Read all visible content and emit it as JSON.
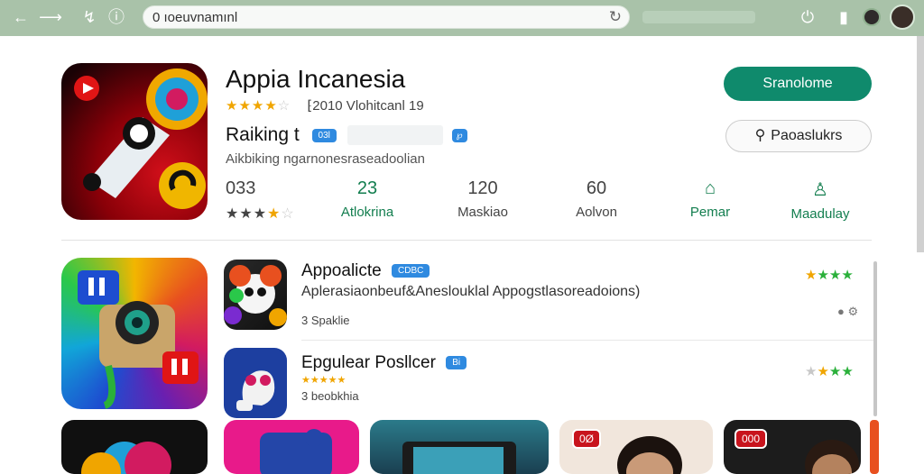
{
  "browser": {
    "url": "0 ıoeuvnamınl",
    "nav": [
      "back-arrow",
      "forward-arrow",
      "history-icon",
      "info-icon"
    ]
  },
  "app": {
    "title": "Appia Incanesia",
    "rating_stars": 4,
    "meta": "⁅2010     Vlohitcanl 19",
    "ranking_label": "Raiking t",
    "ranking_badge": "03l",
    "ranking_badge2": "℘",
    "subtitle": "Aikbiking ngarnonesraseadoolian",
    "stats": [
      {
        "value": "033",
        "label": "",
        "stars": 3
      },
      {
        "value": "23",
        "label": "Atlokrina"
      },
      {
        "value": "120",
        "label": "Maskiao"
      },
      {
        "value": "60",
        "label": "Aolvon"
      },
      {
        "value": "",
        "label": "Pemar"
      },
      {
        "value": "",
        "label": "Maadulay"
      }
    ],
    "install_label": "Sranolome",
    "secondary_label": "Paoaslukrs"
  },
  "list": [
    {
      "title": "Appoalicte",
      "badge": "CDBC",
      "desc": "Aplerasiaonbeuf&Aneslouklal Appogstlasoreadoions)",
      "count": "3 Spaklie",
      "stars": 4
    },
    {
      "title": "Epgulear Posllcer",
      "badge": "Bi",
      "desc": "",
      "count": "3 beobkhia",
      "stars": 4
    }
  ],
  "thumbs": [
    {
      "badge": ""
    },
    {
      "badge": ""
    },
    {
      "badge": ""
    },
    {
      "badge": "0Ø"
    },
    {
      "badge": "000"
    }
  ],
  "colors": {
    "topbar": "#a9c2a9",
    "install": "#0f8a6c",
    "badge": "#2f8ae0",
    "green_text": "#137e4f"
  }
}
